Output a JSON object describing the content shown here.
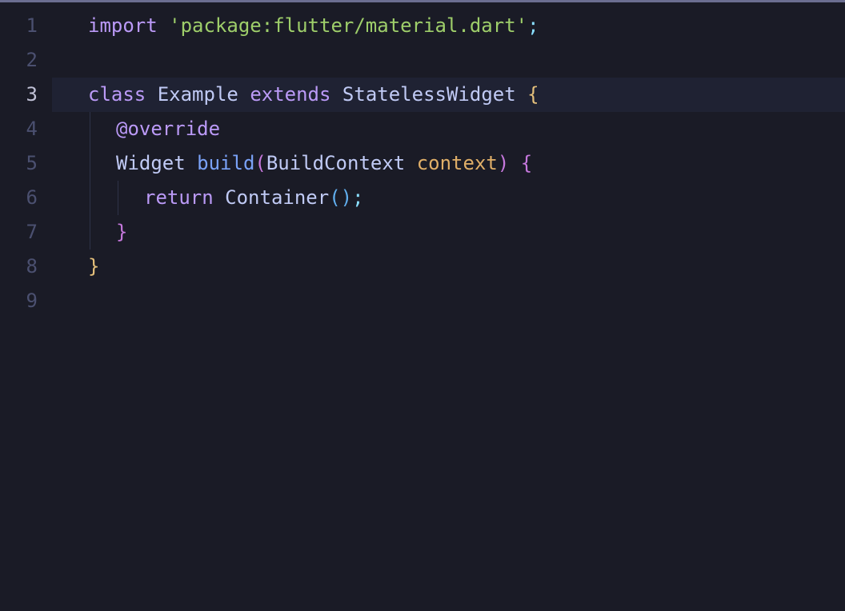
{
  "lineNumbers": [
    "1",
    "2",
    "3",
    "4",
    "5",
    "6",
    "7",
    "8",
    "9"
  ],
  "activeLine": "3",
  "code": {
    "l1": {
      "import": "import",
      "sp1": " ",
      "q1": "'",
      "str": "package:flutter/material.dart",
      "q2": "'",
      "semi": ";"
    },
    "l3": {
      "class": "class",
      "sp1": " ",
      "name": "Example",
      "sp2": " ",
      "extends": "extends",
      "sp3": " ",
      "super": "StatelessWidget",
      "sp4": " ",
      "brace": "{"
    },
    "l4": {
      "ann": "@override"
    },
    "l5": {
      "ret": "Widget",
      "sp1": " ",
      "fn": "build",
      "lp": "(",
      "ptype": "BuildContext",
      "sp2": " ",
      "pname": "context",
      "rp": ")",
      "sp3": " ",
      "brace": "{"
    },
    "l6": {
      "return": "return",
      "sp1": " ",
      "call": "Container",
      "lp": "(",
      "rp": ")",
      "semi": ";"
    },
    "l7": {
      "brace": "}"
    },
    "l8": {
      "brace": "}"
    }
  }
}
